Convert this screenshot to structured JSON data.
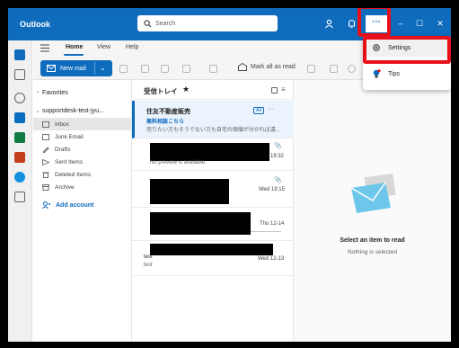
{
  "app": {
    "title": "Outlook"
  },
  "search": {
    "placeholder": "Search"
  },
  "titlebar": {
    "icons": [
      "people-icon",
      "bell-icon",
      "more-icon"
    ],
    "more_label": "···",
    "window_controls": [
      "minimize-icon",
      "restore-icon",
      "close-icon"
    ]
  },
  "ribbon": {
    "tabs": [
      {
        "label": "Home",
        "active": true
      },
      {
        "label": "View",
        "active": false
      },
      {
        "label": "Help",
        "active": false
      }
    ],
    "new_mail_label": "New mail",
    "mark_all_read_label": "Mark all as read"
  },
  "folders": {
    "favorites_label": "Favorites",
    "account_label": "supportdesk-test-jyu...",
    "items": [
      {
        "label": "Inbox",
        "icon": "inbox-icon",
        "selected": true
      },
      {
        "label": "Junk Email",
        "icon": "junk-icon",
        "selected": false
      },
      {
        "label": "Drafts",
        "icon": "drafts-icon",
        "selected": false
      },
      {
        "label": "Sent Items",
        "icon": "sent-icon",
        "selected": false
      },
      {
        "label": "Deleted Items",
        "icon": "trash-icon",
        "selected": false
      },
      {
        "label": "Archive",
        "icon": "archive-icon",
        "selected": false
      }
    ],
    "add_account_label": "Add account"
  },
  "message_list": {
    "title": "受信トレイ",
    "star": "★",
    "messages": [
      {
        "sender": "住友不動産販売",
        "subject": "無料相談こちら",
        "preview": "売りたい方もそうでない方も自宅の価値が分かれば違...",
        "ad": "Ad",
        "more": "···",
        "date": ""
      },
      {
        "sender": "",
        "subject": "",
        "preview": "No preview is available.",
        "date": "19:32",
        "clip": "📎"
      },
      {
        "sender": "",
        "subject": "",
        "preview": "",
        "date": "Wed 19:15",
        "clip": "📎"
      },
      {
        "sender": "",
        "subject": "",
        "preview": "",
        "date": "Thu 12-14"
      },
      {
        "sender": "test",
        "subject": "",
        "preview": "test",
        "date": "Wed 12-13"
      }
    ]
  },
  "reading_pane": {
    "title": "Select an item to read",
    "subtitle": "Nothing is selected"
  },
  "dropdown": {
    "items": [
      {
        "label": "Settings",
        "icon": "gear-icon"
      },
      {
        "label": "Tips",
        "icon": "lightbulb-icon"
      }
    ]
  },
  "colors": {
    "brand": "#0f6cbd",
    "highlight": "#e8101a"
  }
}
